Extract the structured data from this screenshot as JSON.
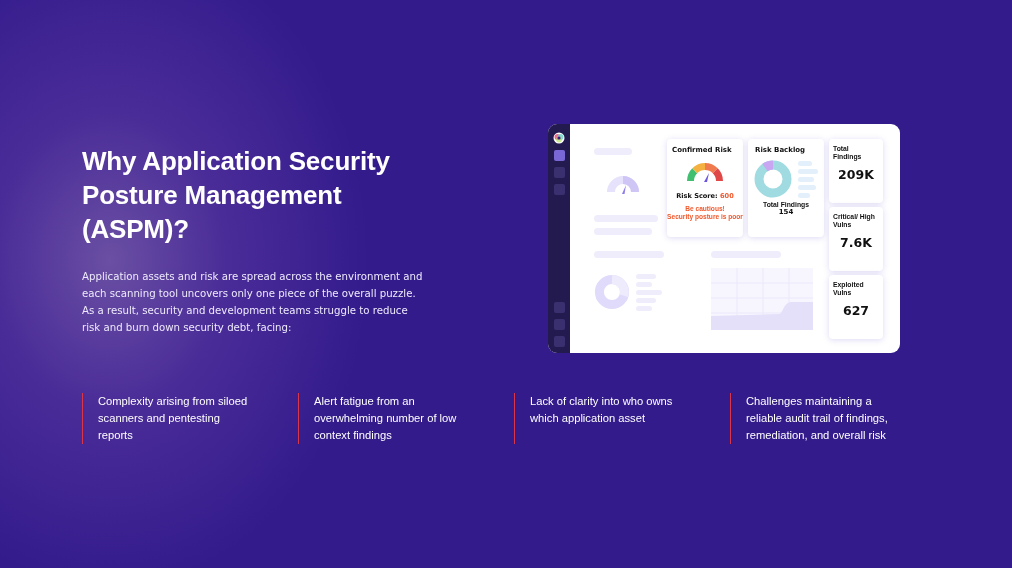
{
  "heading": "Why Application Security Posture Management (ASPM)?",
  "intro": "Application assets and risk are spread across the environment and each scanning tool uncovers only one piece of the overall puzzle. As a result, security and development teams struggle to reduce risk and burn down security debt, facing:",
  "dashboard": {
    "confirmed_risk": {
      "title": "Confirmed Risk",
      "score_label": "Risk Score:",
      "score": "600",
      "warning": [
        "Be cautious!",
        "Security posture is poor"
      ]
    },
    "risk_backlog": {
      "title": "Risk Backlog",
      "total_label": "Total Findings",
      "total": "154"
    },
    "stats": [
      {
        "label": "Total Findings",
        "value": "209K"
      },
      {
        "label": "Critical/ High Vulns",
        "value": "7.6K"
      },
      {
        "label": "Exploited Vulns",
        "value": "627"
      }
    ],
    "nav": [
      {
        "selected": true
      },
      {
        "selected": false
      },
      {
        "selected": false
      }
    ]
  },
  "challenges": [
    "Complexity arising from siloed scanners and pentesting reports",
    "Alert fatigue from an overwhelming number of low context findings",
    "Lack of clarity into who owns which application asset",
    "Challenges maintaining a reliable audit trail of findings, remediation, and overall risk"
  ]
}
